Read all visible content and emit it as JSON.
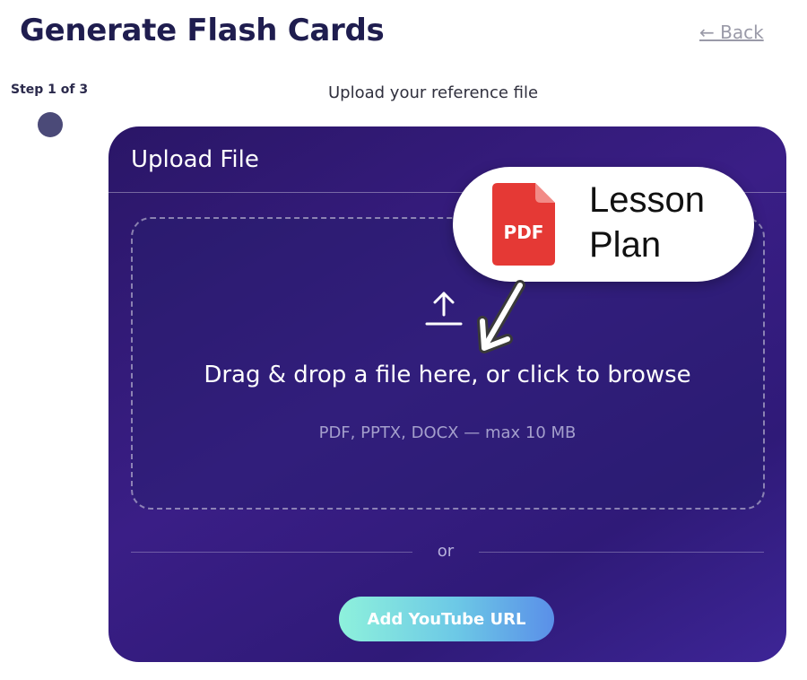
{
  "header": {
    "title": "Generate Flash Cards",
    "back_label": "← Back"
  },
  "stepper": {
    "label": "Step 1 of 3",
    "caption": "Upload your reference file"
  },
  "upload_card": {
    "title": "Upload File",
    "drop_text": "Drag & drop a file here, or click to browse",
    "drop_hint": "PDF, PPTX, DOCX — max 10 MB",
    "divider_text": "or",
    "youtube_button_label": "Add YouTube URL"
  },
  "callout": {
    "icon_label": "PDF",
    "line1": "Lesson",
    "line2": "Plan"
  },
  "colors": {
    "title": "#1f1d4f",
    "card_bg": "#2f1a78",
    "pdf_red": "#e53935",
    "button_gradient_start": "#8ef1dc",
    "button_gradient_end": "#5a8fe8"
  },
  "icons": {
    "upload": "upload-icon",
    "pdf": "pdf-file-icon",
    "arrow": "arrow-down-left-icon"
  }
}
